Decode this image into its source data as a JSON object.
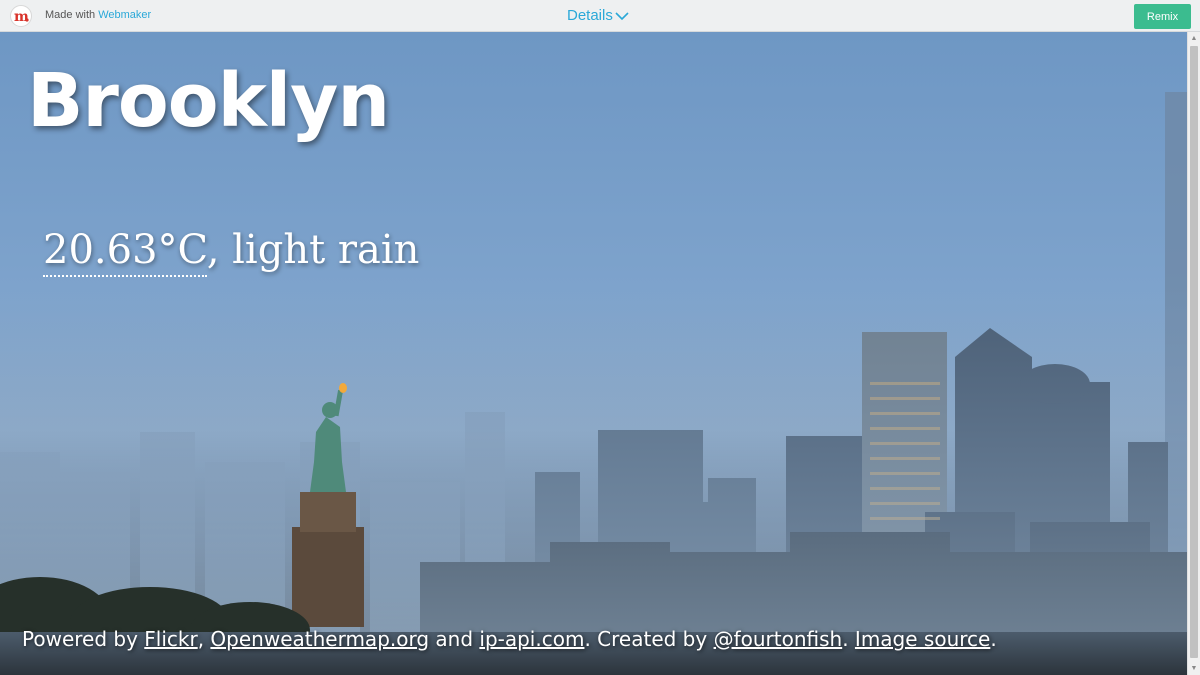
{
  "topbar": {
    "made_with": "Made with",
    "brand": "Webmaker",
    "details": "Details",
    "remix": "Remix"
  },
  "weather": {
    "city": "Brooklyn",
    "temperature": "20.63°C",
    "separator": ", ",
    "condition": "light rain"
  },
  "credits": {
    "powered_by": "Powered by ",
    "flickr": "Flickr",
    "comma1": ", ",
    "openweathermap": "Openweathermap.org",
    "and": " and ",
    "ip_api": "ip-api.com",
    "created_by": ". Created by ",
    "author": "@fourtonfish",
    "period1": ". ",
    "image_source": "Image source",
    "period2": "."
  },
  "colors": {
    "accent": "#2aa8d8",
    "remix_button": "#3bbc8f",
    "topbar_bg": "#eef0f1"
  },
  "icons": [
    "webmaker-logo-icon",
    "chevron-down-icon"
  ]
}
